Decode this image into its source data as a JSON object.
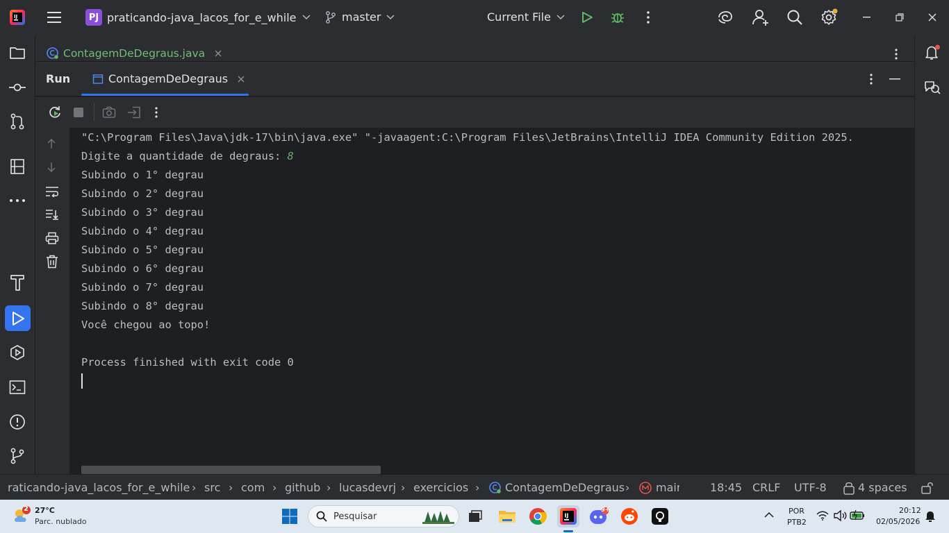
{
  "titlebar": {
    "project_badge": "PJ",
    "project_name": "praticando-java_lacos_for_e_while",
    "branch": "master",
    "run_config": "Current File"
  },
  "editor_tab": {
    "file": "ContagemDeDegraus.java"
  },
  "run_panel": {
    "title": "Run",
    "tab_label": "ContagemDeDegraus"
  },
  "console": {
    "command_line": "\"C:\\Program Files\\Java\\jdk-17\\bin\\java.exe\" \"-javaagent:C:\\Program Files\\JetBrains\\IntelliJ IDEA Community Edition 2025.",
    "prompt": "Digite a quantidade de degraus: ",
    "input_value": "8",
    "lines": [
      "Subindo o 1° degrau",
      "Subindo o 2° degrau",
      "Subindo o 3° degrau",
      "Subindo o 4° degrau",
      "Subindo o 5° degrau",
      "Subindo o 6° degrau",
      "Subindo o 7° degrau",
      "Subindo o 8° degrau",
      "Você chegou ao topo!"
    ],
    "exit_message": "Process finished with exit code 0"
  },
  "statusbar": {
    "breadcrumb": [
      "raticando-java_lacos_for_e_while",
      "src",
      "com",
      "github",
      "lucasdevrj",
      "exercicios",
      "ContagemDeDegraus",
      "main"
    ],
    "position": "18:45",
    "line_ending": "CRLF",
    "encoding": "UTF-8",
    "indent": "4 spaces"
  },
  "taskbar": {
    "weather_temp": "27°C",
    "weather_desc": "Parc. nublado",
    "weather_badge": "2",
    "search_placeholder": "Pesquisar",
    "discord_badge": "9+",
    "lang_top": "POR",
    "lang_bottom": "PTB2",
    "time": "20:12",
    "date": "02/05/2026"
  },
  "colors": {
    "accent": "#3574f0",
    "run_green": "#5fb865",
    "input_green": "#6aab73",
    "file_green": "#73bd79"
  }
}
